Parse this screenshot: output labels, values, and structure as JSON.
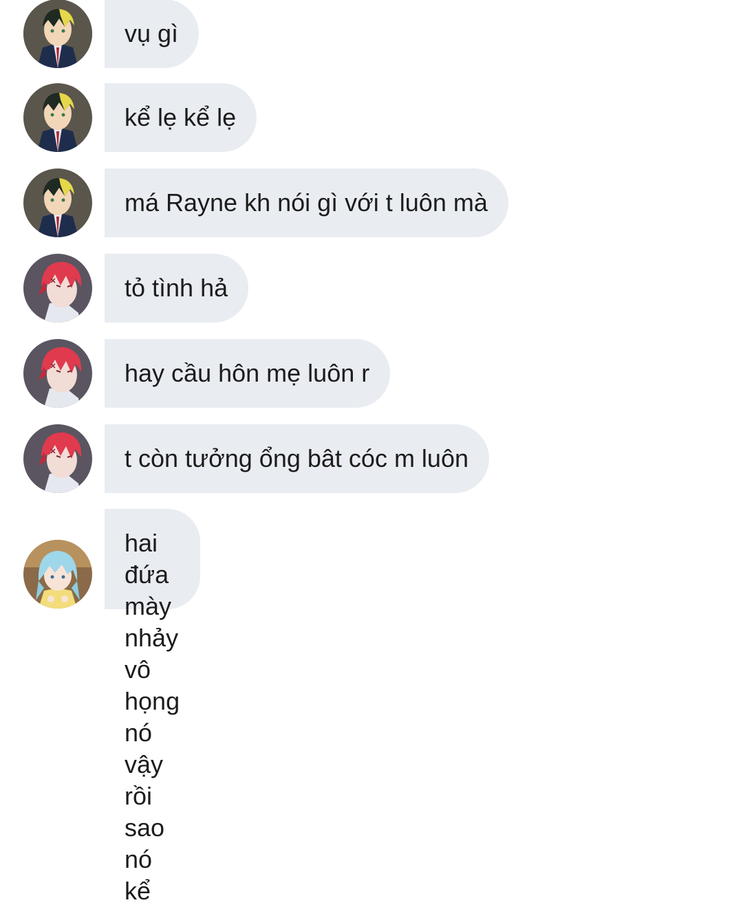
{
  "messages": [
    {
      "sender": "blonde-green-hair-boy",
      "text": "vụ gì"
    },
    {
      "sender": "blonde-green-hair-boy",
      "text": "kể lẹ kể lẹ"
    },
    {
      "sender": "blonde-green-hair-boy",
      "text": "má Rayne kh nói gì với t luôn mà"
    },
    {
      "sender": "red-hair-boy",
      "text": "tỏ tình hả"
    },
    {
      "sender": "red-hair-boy",
      "text": "hay cầu hôn mẹ luôn r"
    },
    {
      "sender": "red-hair-boy",
      "text": "t còn tưởng ổng bât cóc m luôn"
    },
    {
      "sender": "blue-hair-girl",
      "lines": [
        "hai đứa mày nhảy vô họng nó vậy rồi",
        "sao nó kể"
      ]
    }
  ],
  "colors": {
    "bubble_bg": "#e9ecf1",
    "text": "#1c1c1c",
    "background": "#ffffff"
  }
}
